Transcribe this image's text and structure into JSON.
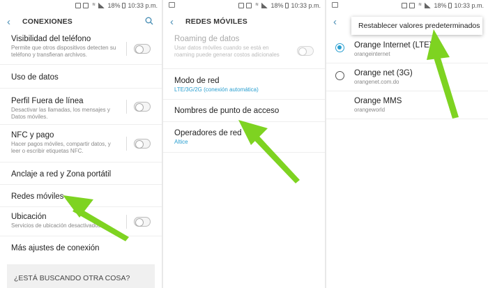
{
  "status": {
    "battery": "18%",
    "time": "10:33 p.m."
  },
  "s1": {
    "title": "CONEXIONES",
    "items": [
      {
        "title": "Visibilidad del teléfono",
        "sub": "Permite que otros dispositivos detecten su teléfono y transfieran archivos."
      },
      {
        "title": "Uso de datos"
      },
      {
        "title": "Perfil Fuera de línea",
        "sub": "Desactivar las llamadas, los mensajes y Datos móviles."
      },
      {
        "title": "NFC y pago",
        "sub": "Hacer pagos móviles, compartir datos, y leer o escribir etiquetas NFC."
      },
      {
        "title": "Anclaje a red y Zona portátil"
      },
      {
        "title": "Redes móviles"
      },
      {
        "title": "Ubicación",
        "sub": "Servicios de ubicación desactivados"
      },
      {
        "title": "Más ajustes de conexión"
      }
    ],
    "suggest": "¿ESTÁ BUSCANDO OTRA COSA?"
  },
  "s2": {
    "title": "REDES MÓVILES",
    "items": [
      {
        "title": "Roaming de datos",
        "sub": "Usar datos móviles cuando se está en roaming puede generar costos adicionales"
      },
      {
        "title": "Modo de red",
        "value": "LTE/3G/2G (conexión automática)"
      },
      {
        "title": "Nombres de punto de acceso"
      },
      {
        "title": "Operadores de red",
        "value": "Altice"
      }
    ]
  },
  "s3": {
    "popup": "Restablecer valores predeterminados",
    "apns": [
      {
        "name": "Orange Internet (LTE)",
        "apn": "orangeinternet"
      },
      {
        "name": "Orange net (3G)",
        "apn": "orangenet.com.do"
      },
      {
        "name": "Orange MMS",
        "apn": "orangeworld"
      }
    ]
  },
  "colors": {
    "accent": "#2a9fd0",
    "arrow": "#7ed321"
  }
}
